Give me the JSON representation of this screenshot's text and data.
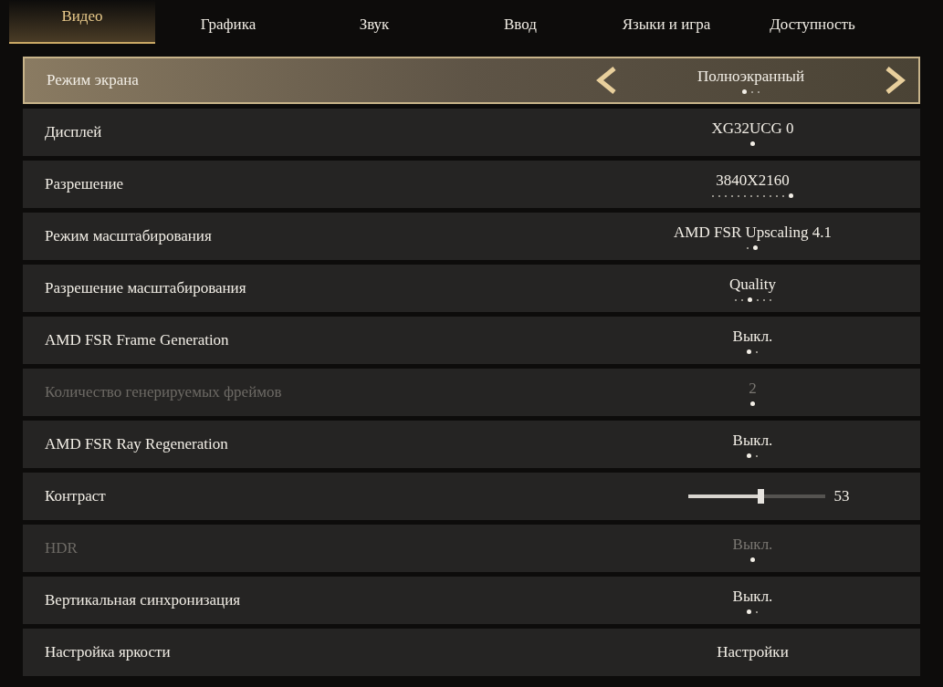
{
  "tabs": [
    {
      "label": "Видео",
      "selected": true
    },
    {
      "label": "Графика",
      "selected": false
    },
    {
      "label": "Звук",
      "selected": false
    },
    {
      "label": "Ввод",
      "selected": false
    },
    {
      "label": "Языки и игра",
      "selected": false
    },
    {
      "label": "Доступность",
      "selected": false
    }
  ],
  "settings": [
    {
      "kind": "selector",
      "label": "Режим экрана",
      "value": "Полноэкранный",
      "selected": true,
      "disabled": false,
      "dots": [
        {
          "selected": true
        },
        {
          "selected": false
        },
        {
          "selected": false
        }
      ]
    },
    {
      "kind": "selector",
      "label": "Дисплей",
      "value": "XG32UCG 0",
      "selected": false,
      "disabled": false,
      "dots": [
        {
          "selected": true
        }
      ]
    },
    {
      "kind": "selector",
      "label": "Разрешение",
      "value": "3840X2160",
      "selected": false,
      "disabled": false,
      "dots": [
        {
          "selected": false
        },
        {
          "selected": false
        },
        {
          "selected": false
        },
        {
          "selected": false
        },
        {
          "selected": false
        },
        {
          "selected": false
        },
        {
          "selected": false
        },
        {
          "selected": false
        },
        {
          "selected": false
        },
        {
          "selected": false
        },
        {
          "selected": false
        },
        {
          "selected": false
        },
        {
          "selected": true
        }
      ]
    },
    {
      "kind": "selector",
      "label": "Режим масштабирования",
      "value": "AMD FSR Upscaling 4.1",
      "selected": false,
      "disabled": false,
      "dots": [
        {
          "selected": false
        },
        {
          "selected": true
        }
      ]
    },
    {
      "kind": "selector",
      "label": "Разрешение масштабирования",
      "value": "Quality",
      "selected": false,
      "disabled": false,
      "dots": [
        {
          "selected": false
        },
        {
          "selected": false
        },
        {
          "selected": true
        },
        {
          "selected": false
        },
        {
          "selected": false
        },
        {
          "selected": false
        }
      ]
    },
    {
      "kind": "selector",
      "label": "AMD FSR Frame Generation",
      "value": "Выкл.",
      "selected": false,
      "disabled": false,
      "dots": [
        {
          "selected": true
        },
        {
          "selected": false
        }
      ]
    },
    {
      "kind": "selector",
      "label": "Количество генерируемых фреймов",
      "value": "2",
      "selected": false,
      "disabled": true,
      "dots": [
        {
          "selected": true
        }
      ]
    },
    {
      "kind": "selector",
      "label": "AMD FSR Ray Regeneration",
      "value": "Выкл.",
      "selected": false,
      "disabled": false,
      "dots": [
        {
          "selected": true
        },
        {
          "selected": false
        }
      ]
    },
    {
      "kind": "slider",
      "label": "Контраст",
      "value": "53",
      "level": 0.53,
      "selected": false,
      "disabled": false
    },
    {
      "kind": "selector",
      "label": "HDR",
      "value": "Выкл.",
      "selected": false,
      "disabled": true,
      "dots": [
        {
          "selected": true
        }
      ]
    },
    {
      "kind": "selector",
      "label": "Вертикальная синхронизация",
      "value": "Выкл.",
      "selected": false,
      "disabled": false,
      "dots": [
        {
          "selected": true
        },
        {
          "selected": false
        }
      ]
    },
    {
      "kind": "button",
      "label": "Настройка яркости",
      "value": "Настройки",
      "selected": false,
      "disabled": false
    }
  ]
}
